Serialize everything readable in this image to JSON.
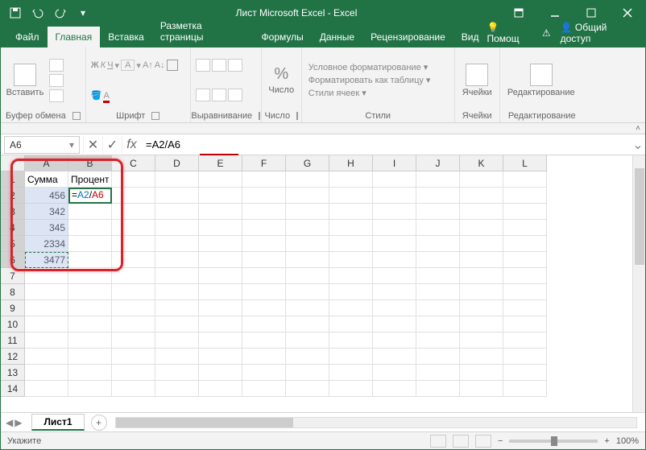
{
  "title": "Лист Microsoft Excel - Excel",
  "tabs": [
    "Файл",
    "Главная",
    "Вставка",
    "Разметка страницы",
    "Формулы",
    "Данные",
    "Рецензирование",
    "Вид"
  ],
  "active_tab": 1,
  "help_label": "Помощ",
  "share_label": "Общий доступ",
  "ribbon": {
    "clipboard": {
      "paste": "Вставить",
      "label": "Буфер обмена"
    },
    "font": {
      "label": "Шрифт"
    },
    "alignment": {
      "label": "Выравнивание"
    },
    "number": {
      "percent": "%",
      "name": "Число",
      "label": "Число"
    },
    "styles": {
      "cond": "Условное форматирование ▾",
      "table": "Форматировать как таблицу ▾",
      "cell": "Стили ячеек ▾",
      "label": "Стили"
    },
    "cells": {
      "name": "Ячейки",
      "label": "Ячейки"
    },
    "editing": {
      "name": "Редактирование",
      "label": "Редактирование"
    }
  },
  "name_box": "A6",
  "formula": "=A2/A6",
  "columns": [
    "A",
    "B",
    "C",
    "D",
    "E",
    "F",
    "G",
    "H",
    "I",
    "J",
    "K",
    "L"
  ],
  "rows_visible": 14,
  "cells": {
    "A1": "Сумма",
    "B1": "Процент",
    "A2": "456",
    "A3": "342",
    "A4": "345",
    "A5": "2334",
    "A6": "3477"
  },
  "b2_formula": {
    "prefix": "=",
    "ref1": "A2",
    "sep": "/",
    "ref2": "A6"
  },
  "sheet": {
    "name": "Лист1"
  },
  "status": {
    "left": "Укажите",
    "zoom": "100%"
  },
  "chart_data": null
}
